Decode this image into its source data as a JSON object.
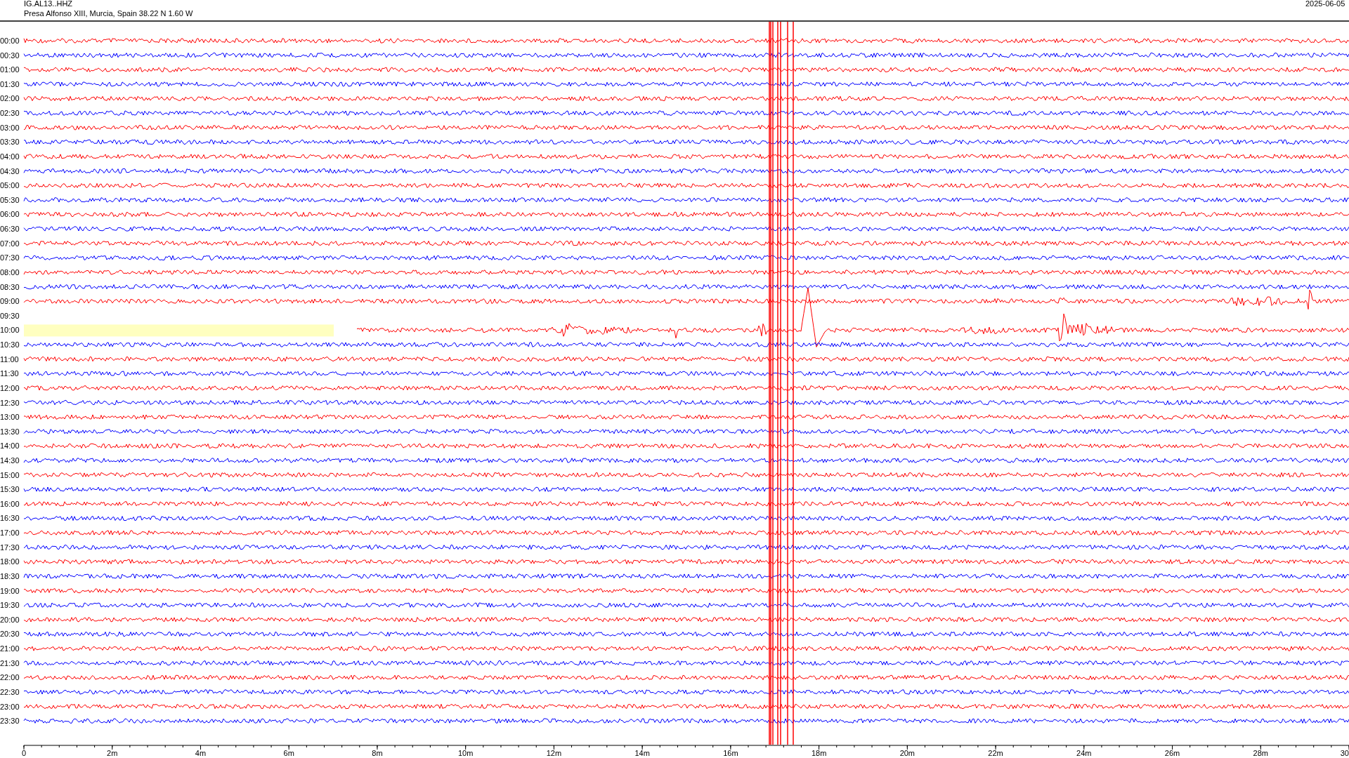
{
  "header": {
    "station": "IG.AL13..HHZ",
    "location": "Presa Alfonso XIII, Murcia, Spain  38.22 N 1.60 W",
    "date": "2025-06-05"
  },
  "rows": [
    {
      "label": "00:00",
      "color": "#ff0000",
      "kind": "trace"
    },
    {
      "label": "00:30",
      "color": "#0000ff",
      "kind": "trace"
    },
    {
      "label": "01:00",
      "color": "#ff0000",
      "kind": "trace"
    },
    {
      "label": "01:30",
      "color": "#0000ff",
      "kind": "trace"
    },
    {
      "label": "02:00",
      "color": "#ff0000",
      "kind": "trace"
    },
    {
      "label": "02:30",
      "color": "#0000ff",
      "kind": "trace"
    },
    {
      "label": "03:00",
      "color": "#ff0000",
      "kind": "trace"
    },
    {
      "label": "03:30",
      "color": "#0000ff",
      "kind": "trace"
    },
    {
      "label": "04:00",
      "color": "#ff0000",
      "kind": "trace"
    },
    {
      "label": "04:30",
      "color": "#0000ff",
      "kind": "trace"
    },
    {
      "label": "05:00",
      "color": "#ff0000",
      "kind": "trace"
    },
    {
      "label": "05:30",
      "color": "#0000ff",
      "kind": "trace"
    },
    {
      "label": "06:00",
      "color": "#ff0000",
      "kind": "trace"
    },
    {
      "label": "06:30",
      "color": "#0000ff",
      "kind": "trace"
    },
    {
      "label": "07:00",
      "color": "#ff0000",
      "kind": "trace"
    },
    {
      "label": "07:30",
      "color": "#0000ff",
      "kind": "trace"
    },
    {
      "label": "08:00",
      "color": "#ff0000",
      "kind": "trace"
    },
    {
      "label": "08:30",
      "color": "#0000ff",
      "kind": "trace"
    },
    {
      "label": "09:00",
      "color": "#ff0000",
      "kind": "event"
    },
    {
      "label": "09:30",
      "kind": "empty"
    },
    {
      "label": "10:00",
      "color": "#ff0000",
      "kind": "gap"
    },
    {
      "label": "10:30",
      "color": "#0000ff",
      "kind": "trace"
    },
    {
      "label": "11:00",
      "color": "#ff0000",
      "kind": "trace"
    },
    {
      "label": "11:30",
      "color": "#0000ff",
      "kind": "trace"
    },
    {
      "label": "12:00",
      "color": "#ff0000",
      "kind": "trace"
    },
    {
      "label": "12:30",
      "color": "#0000ff",
      "kind": "trace"
    },
    {
      "label": "13:00",
      "color": "#ff0000",
      "kind": "trace"
    },
    {
      "label": "13:30",
      "color": "#0000ff",
      "kind": "trace"
    },
    {
      "label": "14:00",
      "color": "#ff0000",
      "kind": "trace"
    },
    {
      "label": "14:30",
      "color": "#0000ff",
      "kind": "trace"
    },
    {
      "label": "15:00",
      "color": "#ff0000",
      "kind": "trace"
    },
    {
      "label": "15:30",
      "color": "#0000ff",
      "kind": "trace"
    },
    {
      "label": "16:00",
      "color": "#ff0000",
      "kind": "trace"
    },
    {
      "label": "16:30",
      "color": "#0000ff",
      "kind": "trace"
    },
    {
      "label": "17:00",
      "color": "#ff0000",
      "kind": "trace"
    },
    {
      "label": "17:30",
      "color": "#0000ff",
      "kind": "trace"
    },
    {
      "label": "18:00",
      "color": "#ff0000",
      "kind": "trace"
    },
    {
      "label": "18:30",
      "color": "#0000ff",
      "kind": "trace"
    },
    {
      "label": "19:00",
      "color": "#ff0000",
      "kind": "trace"
    },
    {
      "label": "19:30",
      "color": "#0000ff",
      "kind": "trace"
    },
    {
      "label": "20:00",
      "color": "#ff0000",
      "kind": "trace"
    },
    {
      "label": "20:30",
      "color": "#0000ff",
      "kind": "trace"
    },
    {
      "label": "21:00",
      "color": "#ff0000",
      "kind": "trace"
    },
    {
      "label": "21:30",
      "color": "#0000ff",
      "kind": "trace"
    },
    {
      "label": "22:00",
      "color": "#ff0000",
      "kind": "trace"
    },
    {
      "label": "22:30",
      "color": "#0000ff",
      "kind": "trace"
    },
    {
      "label": "23:00",
      "color": "#ff0000",
      "kind": "trace"
    },
    {
      "label": "23:30",
      "color": "#0000ff",
      "kind": "trace"
    }
  ],
  "x_axis": {
    "labels": [
      "0",
      "2m",
      "4m",
      "6m",
      "8m",
      "10m",
      "12m",
      "14m",
      "16m",
      "18m",
      "20m",
      "22m",
      "24m",
      "26m",
      "28m",
      "30"
    ]
  }
}
